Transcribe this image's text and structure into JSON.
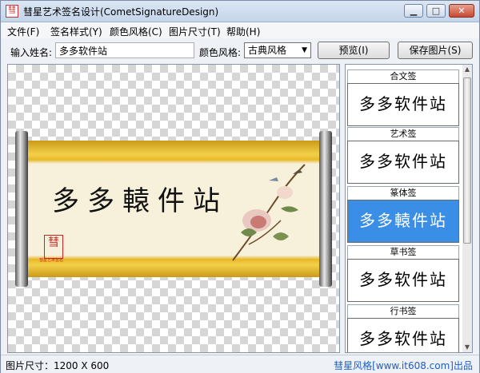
{
  "window": {
    "title": "彗星艺术签名设计(CometSignatureDesign)",
    "icon": "seal-logo-icon"
  },
  "window_controls": {
    "minimize": "▁",
    "maximize": "□",
    "close": "✕"
  },
  "menu": [
    "文件(F)",
    "签名样式(Y)",
    "颜色风格(C)",
    "图片尺寸(T)",
    "帮助(H)"
  ],
  "toolbar": {
    "name_label": "输入姓名:",
    "name_value": "多多软件站",
    "color_label": "颜色风格:",
    "color_value": "古典风格",
    "preview_label": "预览(I)",
    "save_label": "保存图片(S)"
  },
  "preview": {
    "signature_text": "多多轅件站",
    "seal_char": "彗",
    "seal_caption": "彗星艺术签名"
  },
  "styles": [
    {
      "title": "合文签",
      "sample": "多多软件站",
      "selected": false
    },
    {
      "title": "艺术签",
      "sample": "多多软件站",
      "selected": false
    },
    {
      "title": "篆体签",
      "sample": "多多轅件站",
      "selected": true
    },
    {
      "title": "草书签",
      "sample": "多多软件站",
      "selected": false
    },
    {
      "title": "行书签",
      "sample": "多多软件站",
      "selected": false
    }
  ],
  "status": {
    "size_text": "图片尺寸：1200 X 600",
    "credit_text": "彗星风格[www.it608.com]出品"
  }
}
